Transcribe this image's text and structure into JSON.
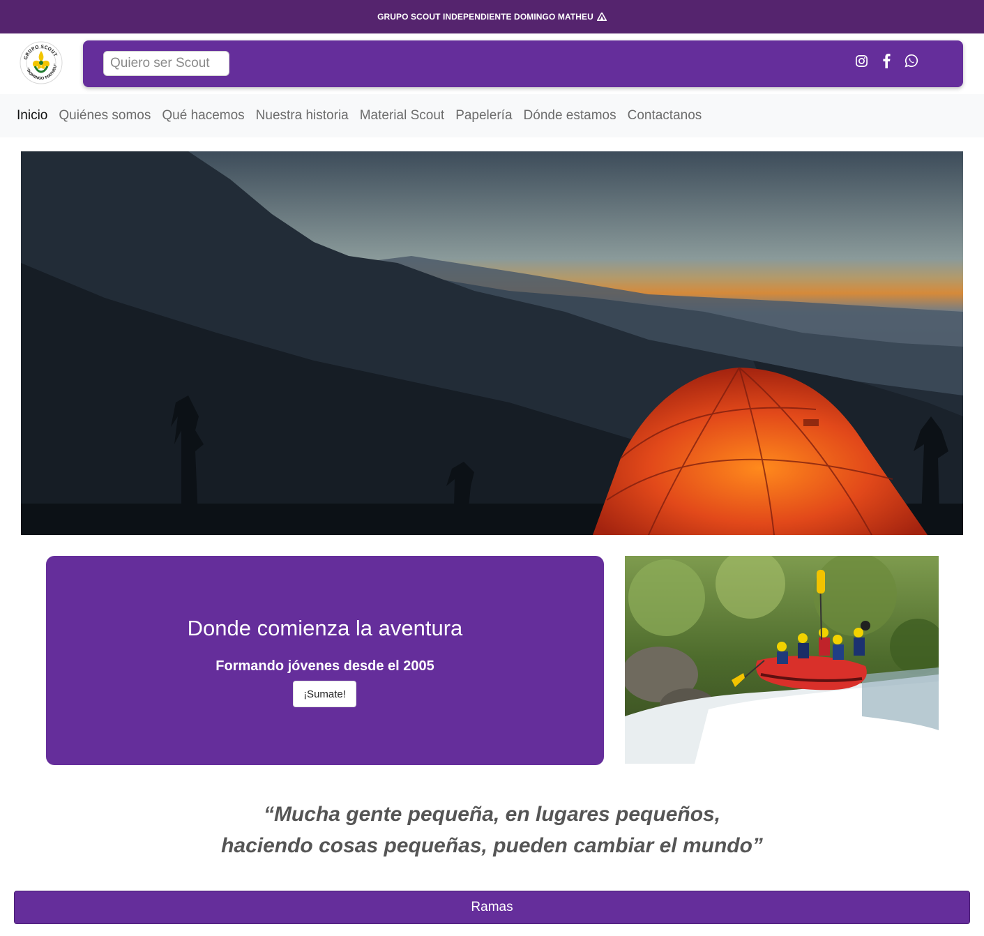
{
  "colors": {
    "topbar": "#55246e",
    "brand_purple": "#652e9b",
    "nav_bg": "#f8f9fa"
  },
  "topbar": {
    "text": "GRUPO SCOUT INDEPENDIENTE DOMINGO MATHEU",
    "icon": "tent-icon"
  },
  "header": {
    "logo_text": "GRUPO SCOUT \"DOMINGO MATHEU\"",
    "cta_label": "Quiero ser Scout",
    "social": [
      "instagram-icon",
      "facebook-icon",
      "whatsapp-icon"
    ]
  },
  "nav": {
    "items": [
      {
        "label": "Inicio",
        "active": true
      },
      {
        "label": "Quiénes somos"
      },
      {
        "label": "Qué hacemos"
      },
      {
        "label": "Nuestra historia"
      },
      {
        "label": "Material Scout"
      },
      {
        "label": "Papelería"
      },
      {
        "label": "Dónde estamos"
      },
      {
        "label": "Contactanos"
      }
    ]
  },
  "promo": {
    "title": "Donde comienza la aventura",
    "subtitle": "Formando jóvenes desde el 2005",
    "button_label": "¡Sumate!"
  },
  "quote": {
    "line1": "“Mucha gente pequeña, en lugares pequeños,",
    "line2": "haciendo cosas pequeñas, pueden cambiar el mundo”"
  },
  "section": {
    "label": "Ramas"
  }
}
